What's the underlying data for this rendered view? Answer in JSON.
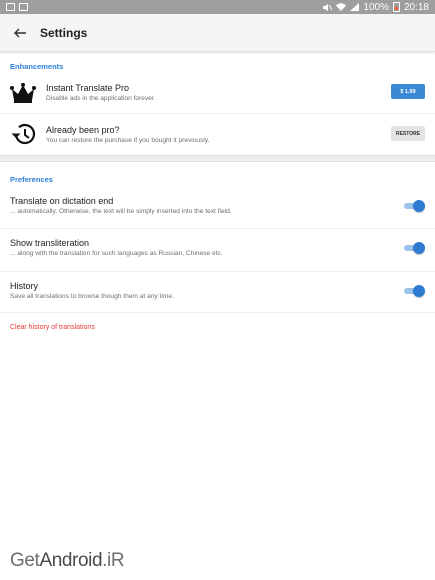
{
  "status_bar": {
    "battery_percent": "100%",
    "time": "20:18",
    "icons": [
      "photo-icon",
      "image-icon",
      "mute-icon",
      "wifi-icon",
      "signal-icon",
      "battery-icon"
    ]
  },
  "app_bar": {
    "title": "Settings",
    "back_icon": "arrow-left-icon"
  },
  "sections": {
    "enhancements": {
      "header": "Enhancements",
      "items": [
        {
          "title": "Instant Translate Pro",
          "subtitle": "Disable ads in the application forever.",
          "icon": "crown-icon",
          "button_label": "$ 1.99"
        },
        {
          "title": "Already been pro?",
          "subtitle": "You can restore the purchase if you bought it previously.",
          "icon": "history-icon",
          "button_label": "RESTORE"
        }
      ]
    },
    "preferences": {
      "header": "Preferences",
      "items": [
        {
          "title": "Translate on dictation end",
          "subtitle": "... automatically. Otherwise, the text will be simply inserted into the text field.",
          "enabled": true
        },
        {
          "title": "Show transliteration",
          "subtitle": "... along with the translation for such languages as Russian, Chinese etc.",
          "enabled": true
        },
        {
          "title": "History",
          "subtitle": "Save all translations to browse though them at any time.",
          "enabled": true
        }
      ],
      "clear_history_label": "Clear history of translations"
    }
  },
  "watermark": {
    "prefix": "Get",
    "brand": "Android",
    "suffix": ".iR"
  },
  "colors": {
    "accent": "#2e7cd2",
    "accent_track": "#9cc3ea",
    "price_button": "#3a89d5",
    "danger": "#e53935",
    "status_bar": "#9e9e9e"
  }
}
